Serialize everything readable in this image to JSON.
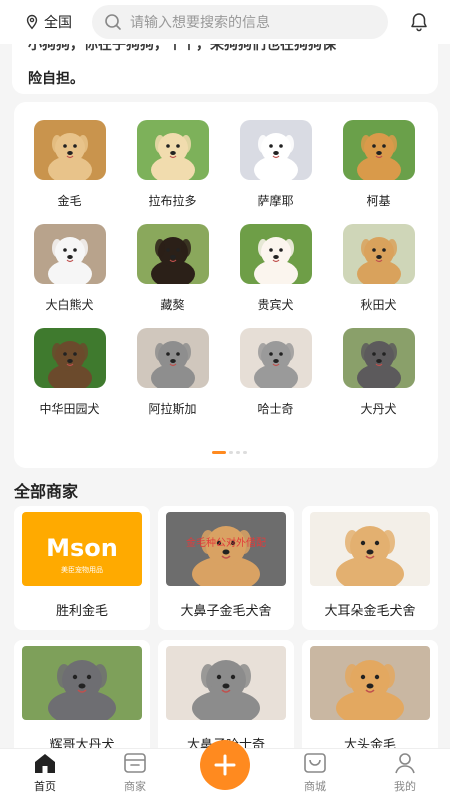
{
  "header": {
    "location": "全国",
    "search_placeholder": "请输入想要搜索的信息",
    "icons": [
      "location-pin-icon",
      "search-icon",
      "bell-icon"
    ]
  },
  "intro": {
    "line1": "小狗狗，你在乎狗狗，个个，来狗狗们也在狗狗保",
    "line2": "险自担。"
  },
  "breeds": [
    {
      "name": "金毛",
      "colors": [
        "#e8c38a",
        "#c9944d"
      ]
    },
    {
      "name": "拉布拉多",
      "colors": [
        "#f1dcae",
        "#7db15a"
      ]
    },
    {
      "name": "萨摩耶",
      "colors": [
        "#ffffff",
        "#d9dbe3"
      ]
    },
    {
      "name": "柯基",
      "colors": [
        "#d99a4a",
        "#6aa04a"
      ]
    },
    {
      "name": "大白熊犬",
      "colors": [
        "#f6f6f6",
        "#b8a38c"
      ]
    },
    {
      "name": "藏獒",
      "colors": [
        "#2b2018",
        "#8aa85c"
      ]
    },
    {
      "name": "贵宾犬",
      "colors": [
        "#fbf5ee",
        "#6e9e47"
      ]
    },
    {
      "name": "秋田犬",
      "colors": [
        "#d9a25c",
        "#cfd6b8"
      ]
    },
    {
      "name": "中华田园犬",
      "colors": [
        "#6b4a2c",
        "#3f7a2e"
      ]
    },
    {
      "name": "阿拉斯加",
      "colors": [
        "#8e8e8e",
        "#d0c7bd"
      ]
    },
    {
      "name": "哈士奇",
      "colors": [
        "#9a9a9a",
        "#e6ded6"
      ]
    },
    {
      "name": "大丹犬",
      "colors": [
        "#5c5a5c",
        "#8aa06a"
      ]
    }
  ],
  "pager": {
    "active": 0,
    "count": 4
  },
  "section_title": "全部商家",
  "merchants": [
    {
      "name": "胜利金毛",
      "banner": "Mson",
      "sub": "美臣宠物用品",
      "colors": [
        "#ffaa00",
        "#ffffff"
      ]
    },
    {
      "name": "大鼻子金毛犬舍",
      "banner": "金毛种公对外借配",
      "colors": [
        "#d9a263",
        "#6d6d6d"
      ]
    },
    {
      "name": "大耳朵金毛犬舍",
      "colors": [
        "#e3b070",
        "#f3efe8"
      ]
    },
    {
      "name": "辉哥大丹犬",
      "colors": [
        "#6e6e72",
        "#7ea05a"
      ]
    },
    {
      "name": "大鼻子哈士奇",
      "colors": [
        "#8c8c8c",
        "#e8e0d8"
      ]
    },
    {
      "name": "大头金毛",
      "colors": [
        "#e3a860",
        "#c9b7a2"
      ]
    }
  ],
  "nav": {
    "items": [
      {
        "label": "首页",
        "icon": "home-icon",
        "active": true
      },
      {
        "label": "商家",
        "icon": "store-icon",
        "active": false
      },
      {
        "label": "",
        "icon": "plus-icon",
        "active": false
      },
      {
        "label": "商城",
        "icon": "shop-bag-icon",
        "active": false
      },
      {
        "label": "我的",
        "icon": "user-icon",
        "active": false
      }
    ],
    "accent": "#ff8a1f"
  }
}
